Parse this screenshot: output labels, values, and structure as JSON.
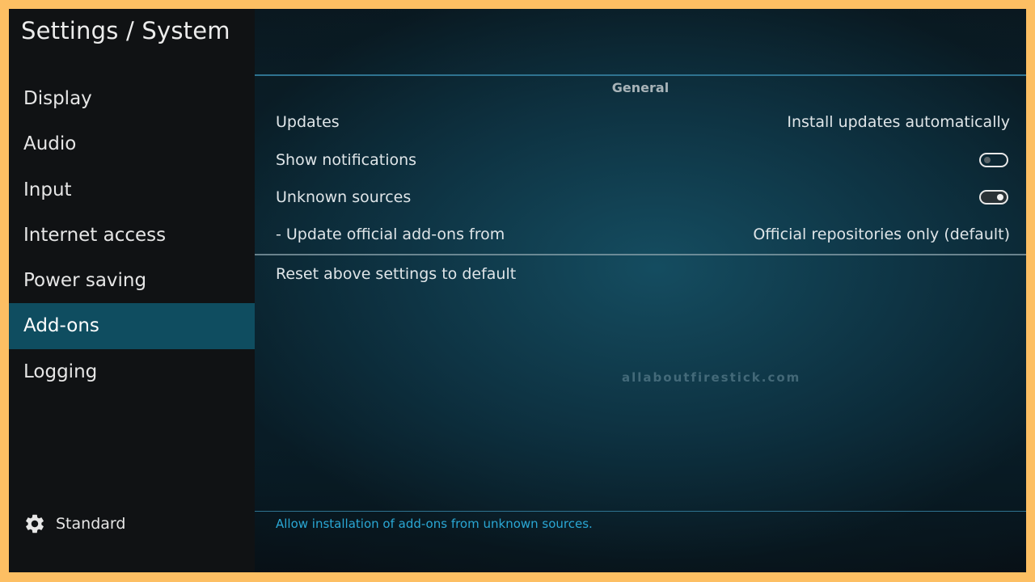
{
  "window": {
    "title": "Settings / System"
  },
  "sidebar": {
    "items": [
      {
        "label": "Display"
      },
      {
        "label": "Audio"
      },
      {
        "label": "Input"
      },
      {
        "label": "Internet access"
      },
      {
        "label": "Power saving"
      },
      {
        "label": "Add-ons",
        "active": true
      },
      {
        "label": "Logging"
      }
    ],
    "profile": {
      "icon": "gear-icon",
      "label": "Standard"
    }
  },
  "main": {
    "section": "General",
    "settings": [
      {
        "label": "Updates",
        "value": "Install updates automatically"
      },
      {
        "label": "Show notifications",
        "toggle": "off"
      },
      {
        "label": "Unknown sources",
        "toggle": "on"
      },
      {
        "label": "- Update official add-ons from",
        "value": "Official repositories only (default)"
      }
    ],
    "reset_label": "Reset above settings to default",
    "watermark": "allaboutfirestick.com",
    "hint": "Allow installation of add-ons from unknown sources."
  },
  "colors": {
    "accent": "#0f4d60",
    "hint": "#2aa7d4",
    "border": "#fdbf63"
  }
}
